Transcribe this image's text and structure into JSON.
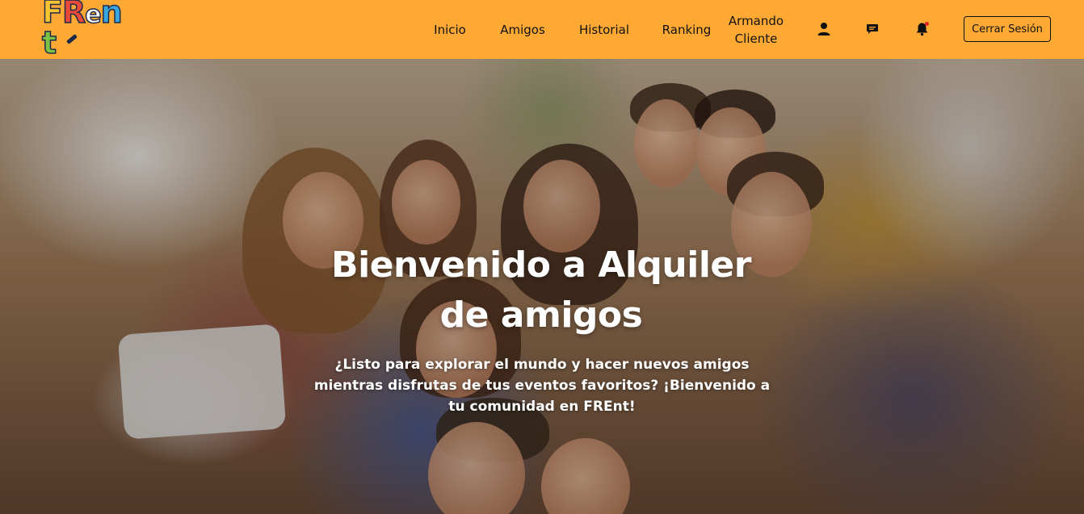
{
  "brand": {
    "logo_letters": [
      "F",
      "R",
      "e",
      "n",
      "t"
    ],
    "colors": {
      "navbar": "#ffa935",
      "text": "#111111",
      "notification_dot": "#e3262b"
    }
  },
  "nav": {
    "links": [
      "Inicio",
      "Amigos",
      "Historial",
      "Ranking",
      "Armando Cliente"
    ],
    "icons": [
      "user-icon",
      "chat-icon",
      "bell-icon"
    ],
    "logout_label": "Cerrar Sesión"
  },
  "hero": {
    "title": "Bienvenido a Alquiler de amigos",
    "subtitle": "¿Listo para explorar el mundo y hacer nuevos amigos mientras disfrutas de tus eventos favoritos? ¡Bienvenido a tu comunidad en FREnt!"
  }
}
